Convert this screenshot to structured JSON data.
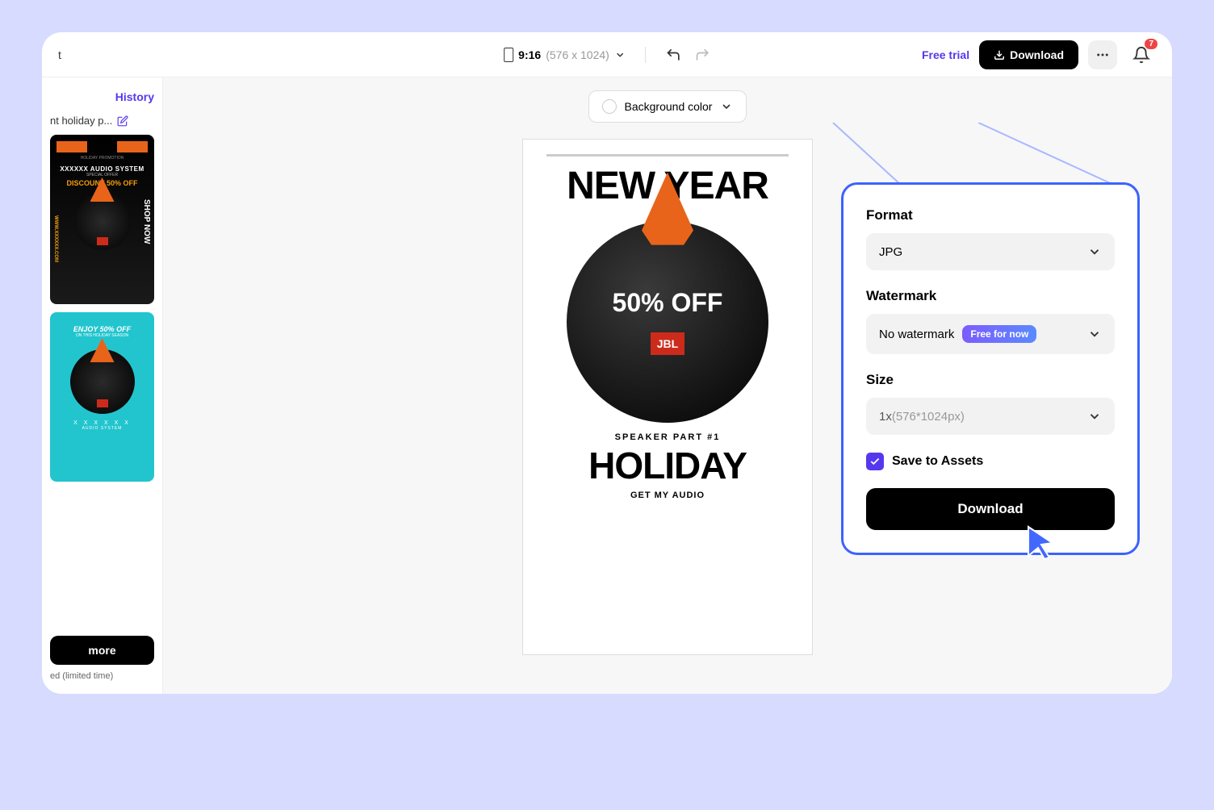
{
  "topbar": {
    "aspect_ratio": "9:16",
    "dimensions": "(576 x 1024)",
    "free_trial": "Free trial",
    "download": "Download",
    "notifications": "7"
  },
  "sidebar": {
    "history_label": "History",
    "project_name": "nt holiday p...",
    "thumb1": {
      "promo_tag": "HOLIDAY PROMOTION",
      "title": "XXXXXX AUDIO SYSTEM",
      "subtitle": "SPECIAL OFFER",
      "discount": "DISCOUNT 50% OFF",
      "shop": "SHOP NOW",
      "url": "WWW.XXXXXX.COM"
    },
    "thumb2": {
      "title": "ENJOY 50% OFF",
      "subtitle": "ON THIS HOLIDAY SEASON",
      "xs": "X X X X X X",
      "audio": "AUDIO SYSTEM"
    },
    "more_btn": "more",
    "limited": "ed (limited time)"
  },
  "canvas": {
    "bg_color_label": "Background color",
    "preview": {
      "title": "NEW YEAR",
      "off": "50% OFF",
      "brand": "JBL",
      "sub": "SPEAKER  PART #1",
      "holiday": "HOLIDAY",
      "cta": "GET MY AUDIO"
    }
  },
  "export": {
    "format_label": "Format",
    "format_value": "JPG",
    "watermark_label": "Watermark",
    "watermark_value": "No watermark",
    "free_badge": "Free for now",
    "size_label": "Size",
    "size_multiplier": "1x",
    "size_px": "(576*1024px)",
    "save_assets": "Save to Assets",
    "download": "Download"
  }
}
